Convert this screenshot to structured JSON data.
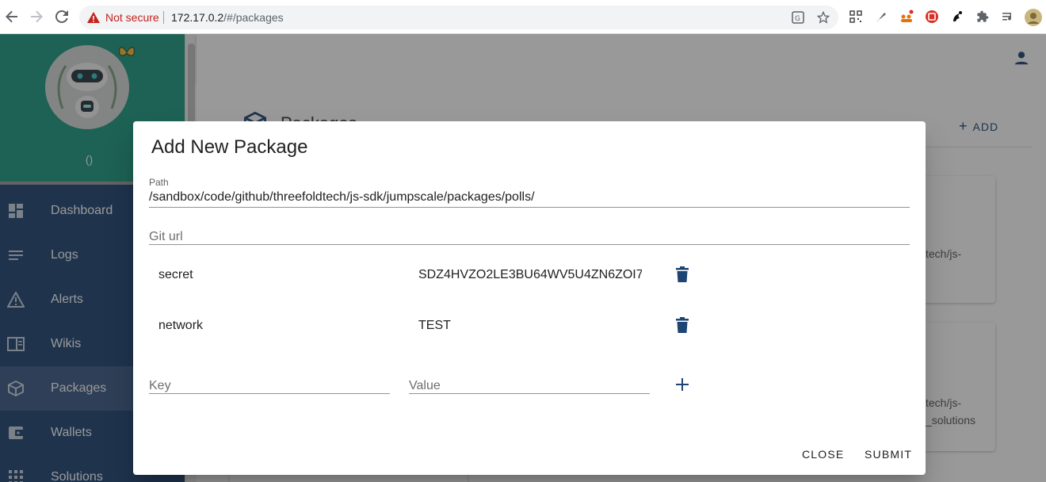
{
  "browser": {
    "security_label": "Not secure",
    "url_host": "172.17.0.2",
    "url_path": "/#/packages"
  },
  "sidebar": {
    "user_label": "()",
    "items": [
      {
        "label": "Dashboard",
        "icon": "dashboard-icon"
      },
      {
        "label": "Logs",
        "icon": "logs-icon"
      },
      {
        "label": "Alerts",
        "icon": "alert-icon"
      },
      {
        "label": "Wikis",
        "icon": "wiki-icon"
      },
      {
        "label": "Packages",
        "icon": "package-icon",
        "active": true
      },
      {
        "label": "Wallets",
        "icon": "wallet-icon"
      },
      {
        "label": "Solutions",
        "icon": "solutions-icon"
      }
    ]
  },
  "page": {
    "title": "Packages",
    "add_label": "ADD",
    "card_texts": [
      "tech/js-",
      "tech/js-",
      "_solutions"
    ]
  },
  "dialog": {
    "title": "Add New Package",
    "path_label": "Path",
    "path_value": "/sandbox/code/github/threefoldtech/js-sdk/jumpscale/packages/polls/",
    "git_url_placeholder": "Git url",
    "kv_rows": [
      {
        "key": "secret",
        "value": "SDZ4HVZO2LE3BU64WV5U4ZN6ZOI7"
      },
      {
        "key": "network",
        "value": "TEST"
      }
    ],
    "key_placeholder": "Key",
    "value_placeholder": "Value",
    "close_label": "CLOSE",
    "submit_label": "SUBMIT"
  },
  "colors": {
    "sidebar": "#1e4473",
    "sidebar_header": "#1b9a80",
    "accent": "#1e4473",
    "not_secure": "#c5221f"
  }
}
